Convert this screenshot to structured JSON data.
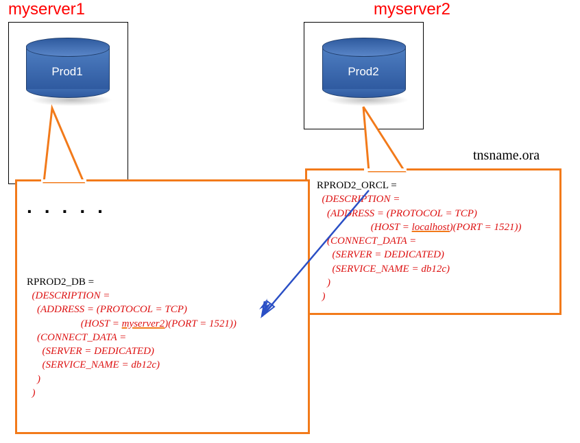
{
  "servers": {
    "s1": {
      "title": "myserver1",
      "db_label": "Prod1"
    },
    "s2": {
      "title": "myserver2",
      "db_label": "Prod2"
    }
  },
  "file_label": "tnsname.ora",
  "ellipsis": ".....",
  "callout_left": {
    "name_line": "RPROD2_DB =",
    "desc": "  (DESCRIPTION =",
    "addr1": "    (ADDRESS = (PROTOCOL = TCP)",
    "addr2a": "                     (HOST = ",
    "addr2_host": "myserver2",
    "addr2b": ")(PORT = 1521))",
    "cdata": "    (CONNECT_DATA =",
    "server": "      (SERVER = DEDICATED)",
    "svc": "      (SERVICE_NAME = db12c)",
    "close1": "    )",
    "close2": "  )"
  },
  "callout_right": {
    "name_line": "RPROD2_ORCL =",
    "desc": "  (DESCRIPTION =",
    "addr1": "    (ADDRESS = (PROTOCOL = TCP)",
    "addr2a": "                     (HOST = ",
    "addr2_host": "localhost",
    "addr2b": ")(PORT = 1521))",
    "cdata": "    (CONNECT_DATA =",
    "server": "      (SERVER = DEDICATED)",
    "svc": "      (SERVICE_NAME = db12c)",
    "close1": "    )",
    "close2": "  )"
  },
  "colors": {
    "accent_orange": "#f27a1a",
    "text_red": "#d11",
    "arrow_blue": "#2a4fc5",
    "db_blue": "#3b6bb5"
  }
}
